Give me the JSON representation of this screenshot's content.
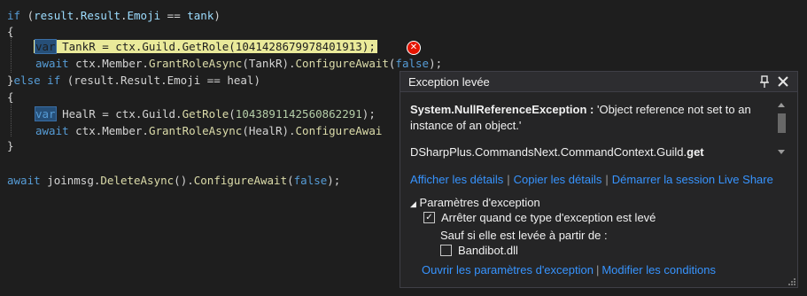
{
  "code": {
    "l1": [
      "if",
      " (",
      "result",
      ".",
      "Result",
      ".",
      "Emoji",
      " == ",
      "tank",
      ")"
    ],
    "l2": "{",
    "l3": {
      "var": "var",
      "rest_a": " TankR = ctx.Guild.",
      "fn": "GetRole",
      "num": "1041428679978401913",
      "end": ");"
    },
    "l4": {
      "await": "await",
      "a": " ctx.Member.",
      "fn1": "GrantRoleAsync",
      "b": "(TankR).",
      "fn2": "ConfigureAwait",
      "c": "(",
      "kw": "false",
      "d": ");"
    },
    "l5": {
      "a": "}",
      "else": "else",
      "if": " if",
      "b": " (result.Result.Emoji == heal)"
    },
    "l6": "{",
    "l7": {
      "var": "var",
      "rest_a": " HealR = ctx.Guild.",
      "fn": "GetRole",
      "num": "1043891142560862291",
      "end": ");"
    },
    "l8": {
      "await": "await",
      "a": " ctx.Member.",
      "fn1": "GrantRoleAsync",
      "b": "(HealR).",
      "fn2": "ConfigureAwai"
    },
    "l9": "}",
    "l11": {
      "await": "await",
      "a": " joinmsg.",
      "fn1": "DeleteAsync",
      "b": "().",
      "fn2": "ConfigureAwait",
      "c": "(",
      "kw": "false",
      "d": ");"
    }
  },
  "popup": {
    "title": "Exception levée",
    "exception_type": "System.NullReferenceException :",
    "exception_msg": " 'Object reference not set to an instance of an object.'",
    "source_prefix": "DSharpPlus.CommandsNext.CommandContext.Guild.",
    "source_member": "get",
    "link_details": "Afficher les détails",
    "link_copy": "Copier les détails",
    "link_liveshare": "Démarrer la session Live Share",
    "section_label": "Paramètres d'exception",
    "break_label": "Arrêter quand ce type d'exception est levé",
    "break_checked": true,
    "unless_label": "Sauf si elle est levée à partir de :",
    "module_label": "Bandibot.dll",
    "module_checked": false,
    "link_open_settings": "Ouvrir les paramètres d'exception",
    "link_edit_conditions": "Modifier les conditions"
  },
  "colors": {
    "keyword": "#569cd6",
    "function": "#dcdcaa",
    "number": "#b5cea8",
    "link": "#3794ff",
    "error": "#e51400"
  }
}
